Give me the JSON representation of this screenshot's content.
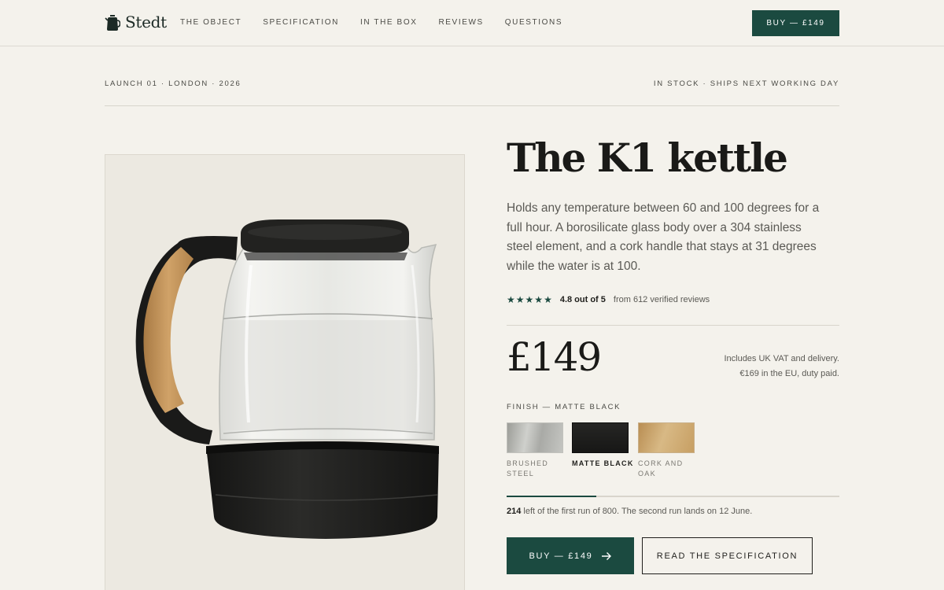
{
  "brand": {
    "name": "Stedt",
    "logo_icon": "kettle-icon"
  },
  "nav": {
    "items": [
      {
        "label": "THE OBJECT"
      },
      {
        "label": "SPECIFICATION"
      },
      {
        "label": "IN THE BOX"
      },
      {
        "label": "REVIEWS"
      },
      {
        "label": "QUESTIONS"
      }
    ]
  },
  "header": {
    "buy_label": "BUY — £149"
  },
  "meta": {
    "left": "LAUNCH 01 · LONDON · 2026",
    "right": "IN STOCK · SHIPS NEXT WORKING DAY"
  },
  "product": {
    "title": "The K1 kettle",
    "description": "Holds any temperature between 60 and 100 degrees for a full hour. A borosilicate glass body over a 304 stainless steel element, and a cork handle that stays at 31 degrees while the water is at 100.",
    "rating": {
      "stars": 5,
      "score": "4.8 out of 5",
      "count": "from 612 verified reviews"
    },
    "price": "£149",
    "price_note_line1": "Includes UK VAT and delivery.",
    "price_note_line2": "€169 in the EU, duty paid."
  },
  "finish": {
    "label": "FINISH — MATTE BLACK",
    "selected": "MATTE BLACK",
    "options": [
      {
        "label": "BRUSHED STEEL",
        "color": "#bfc0bb"
      },
      {
        "label": "MATTE BLACK",
        "color": "#1e1e1c"
      },
      {
        "label": "CORK AND OAK",
        "color": "#cba872"
      }
    ]
  },
  "stock": {
    "remaining": "214",
    "text": "left of the first run of 800. The second run lands on 12 June.",
    "fraction_sold": 0.27
  },
  "actions": {
    "buy_label": "BUY — £149",
    "buy_icon": "arrow-right-icon",
    "spec_label": "READ THE SPECIFICATION"
  },
  "colors": {
    "accent": "#1b4a40",
    "background": "#f4f2ec",
    "panel": "#ece9e1"
  }
}
